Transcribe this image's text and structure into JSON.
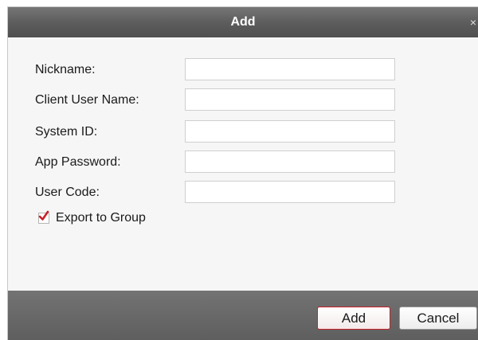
{
  "dialog": {
    "title": "Add",
    "close_glyph": "×"
  },
  "form": {
    "fields": [
      {
        "label": "Nickname:",
        "value": "",
        "placeholder": ""
      },
      {
        "label": "Client User Name:",
        "value": "",
        "placeholder": ""
      },
      {
        "label": "System ID:",
        "value": "",
        "placeholder": ""
      },
      {
        "label": "App Password:",
        "value": "",
        "placeholder": ""
      },
      {
        "label": "User Code:",
        "value": "",
        "placeholder": ""
      }
    ],
    "export_to_group": {
      "label": "Export to Group",
      "checked": true
    }
  },
  "footer": {
    "add_label": "Add",
    "cancel_label": "Cancel"
  },
  "colors": {
    "titlebar": "#5d5d5d",
    "checkmark": "#c8202a",
    "add_border": "#c8202a"
  }
}
